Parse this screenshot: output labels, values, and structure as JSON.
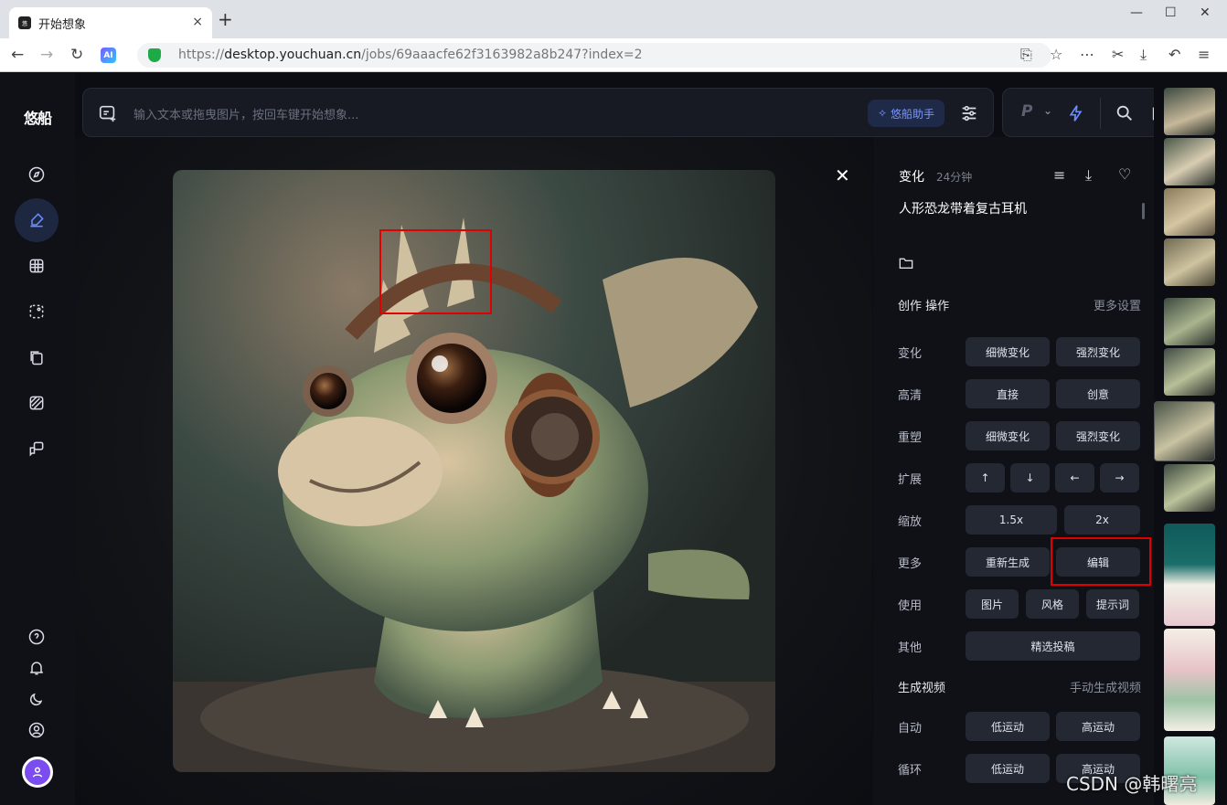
{
  "browser": {
    "tab_title": "开始想象",
    "tab_close": "×",
    "new_tab": "+",
    "url_prefix": "https://",
    "url_host": "desktop.youchuan.cn",
    "url_path": "/jobs/69aaacfe62f3163982a8b247?index=2",
    "window_min": "—",
    "window_max": "☐",
    "window_close": "✕"
  },
  "app": {
    "logo": "悠船",
    "prompt_placeholder": "输入文本或拖曳图片，按回车键开始想象...",
    "assistant_label": "悠船助手",
    "version_label": "P"
  },
  "viewer": {
    "close": "✕"
  },
  "panel": {
    "heading": "变化",
    "time": "24分钟",
    "prompt": "人形恐龙带着复古耳机",
    "create_ops": "创作 操作",
    "more_settings": "更多设置",
    "rows": [
      {
        "label": "变化",
        "buttons": [
          "细微变化",
          "强烈变化"
        ]
      },
      {
        "label": "高清",
        "buttons": [
          "直接",
          "创意"
        ]
      },
      {
        "label": "重塑",
        "buttons": [
          "细微变化",
          "强烈变化"
        ]
      },
      {
        "label": "扩展",
        "buttons": [
          "↑",
          "↓",
          "←",
          "→"
        ]
      },
      {
        "label": "缩放",
        "buttons": [
          "1.5x",
          "2x"
        ]
      },
      {
        "label": "更多",
        "buttons": [
          "重新生成",
          "编辑"
        ]
      },
      {
        "label": "使用",
        "buttons": [
          "图片",
          "风格",
          "提示词"
        ]
      },
      {
        "label": "其他",
        "buttons": [
          "精选投稿"
        ]
      }
    ],
    "video_heading": "生成视频",
    "video_manual": "手动生成视频",
    "video_rows": [
      {
        "label": "自动",
        "buttons": [
          "低运动",
          "高运动"
        ]
      },
      {
        "label": "循环",
        "buttons": [
          "低运动",
          "高运动"
        ]
      }
    ]
  },
  "watermark": "CSDN @韩曙亮",
  "colors": {
    "accent": "#6d8cff",
    "highlight": "#e00000",
    "panel_bg": "#0f1117",
    "button_bg": "#242833"
  }
}
